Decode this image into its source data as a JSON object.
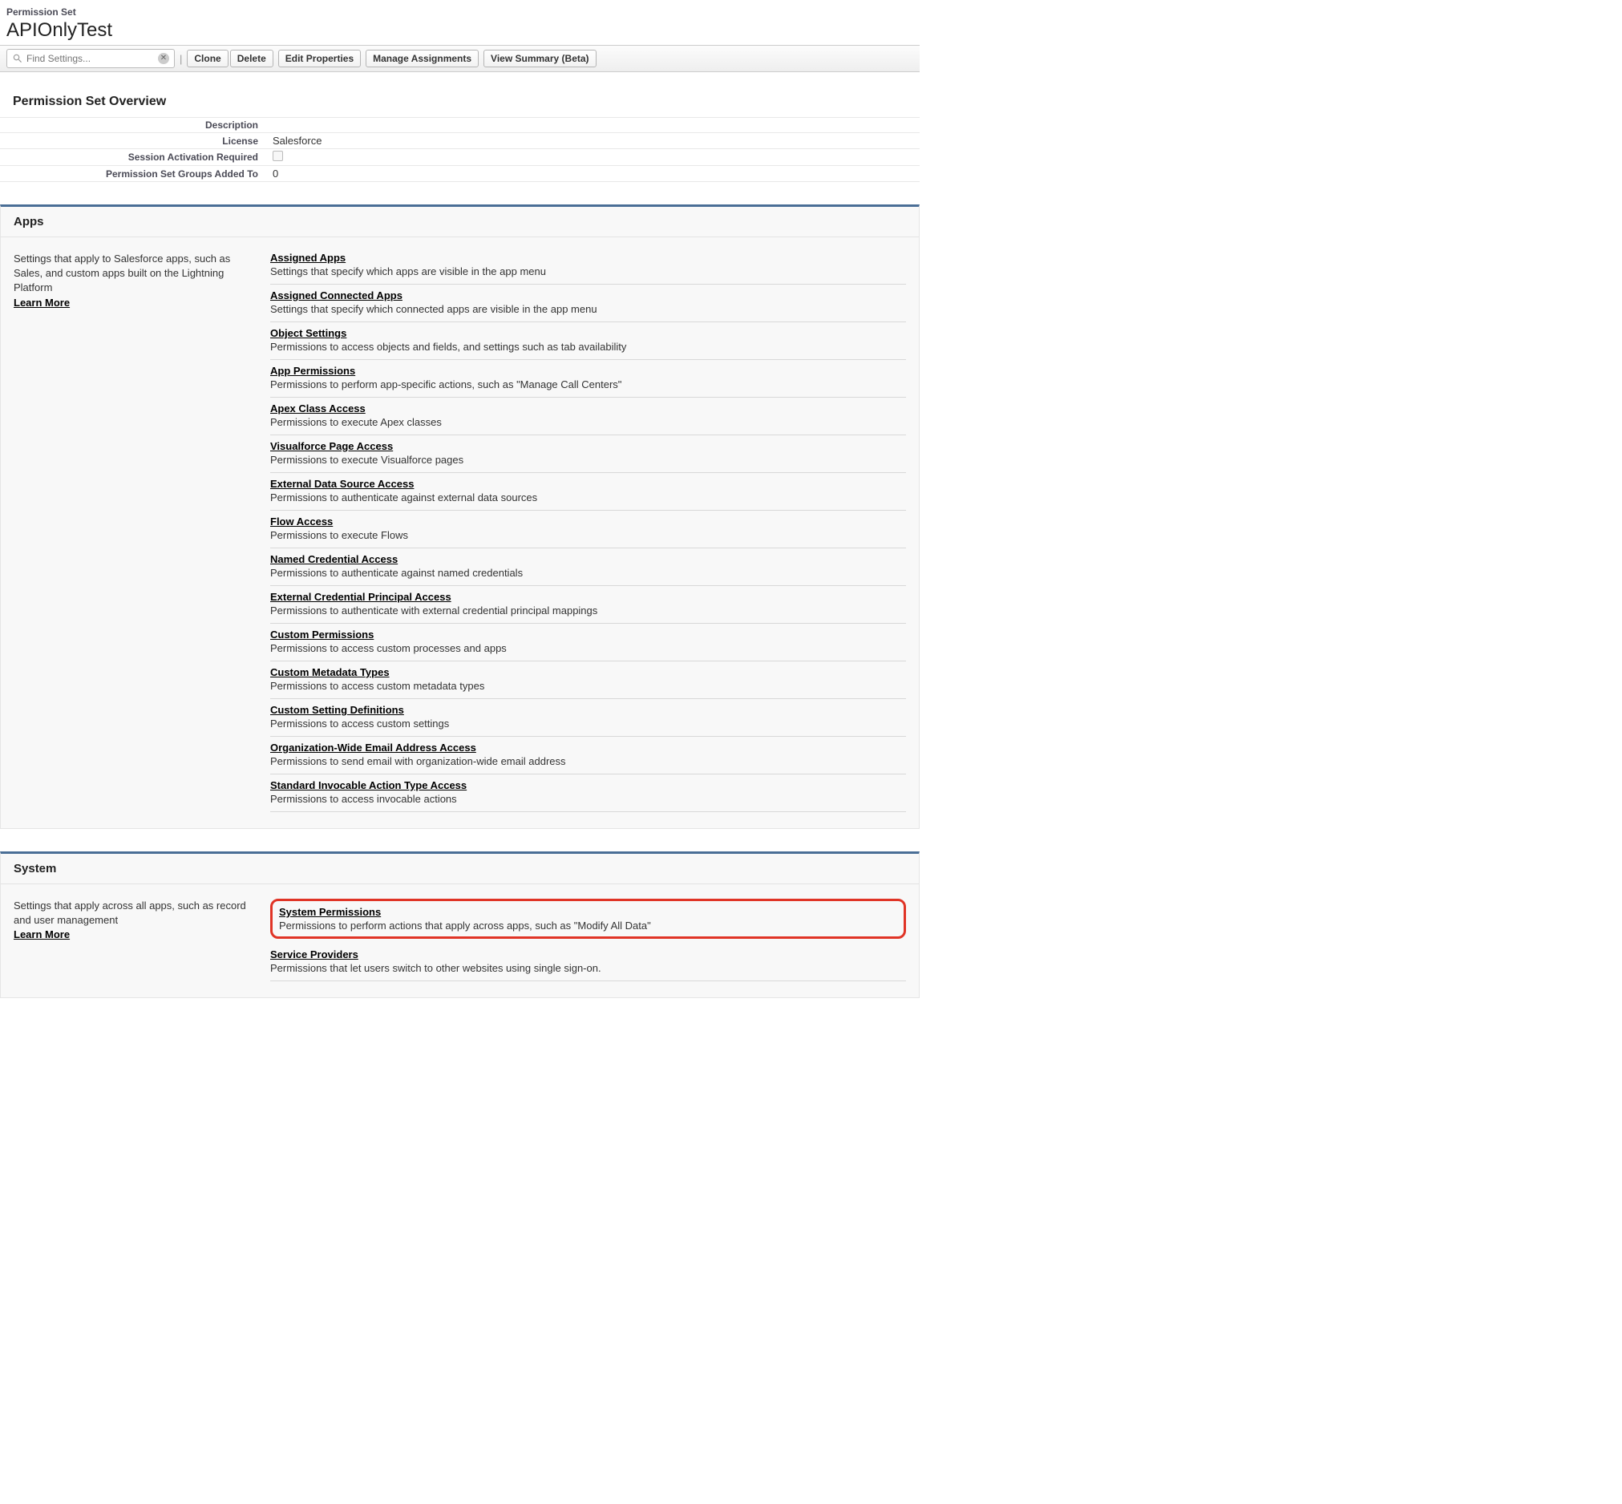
{
  "header": {
    "type_label": "Permission Set",
    "title": "APIOnlyTest"
  },
  "toolbar": {
    "search_placeholder": "Find Settings...",
    "buttons": {
      "clone": "Clone",
      "delete": "Delete",
      "edit_properties": "Edit Properties",
      "manage_assignments": "Manage Assignments",
      "view_summary": "View Summary (Beta)"
    }
  },
  "overview": {
    "title": "Permission Set Overview",
    "rows": {
      "description_label": "Description",
      "description_value": "",
      "license_label": "License",
      "license_value": "Salesforce",
      "session_label": "Session Activation Required",
      "groups_label": "Permission Set Groups Added To",
      "groups_value": "0"
    }
  },
  "apps_section": {
    "title": "Apps",
    "blurb": "Settings that apply to Salesforce apps, such as Sales, and custom apps built on the Lightning Platform",
    "learn_more": "Learn More",
    "items": [
      {
        "title": "Assigned Apps",
        "desc": "Settings that specify which apps are visible in the app menu"
      },
      {
        "title": "Assigned Connected Apps",
        "desc": "Settings that specify which connected apps are visible in the app menu"
      },
      {
        "title": "Object Settings",
        "desc": "Permissions to access objects and fields, and settings such as tab availability"
      },
      {
        "title": "App Permissions",
        "desc": "Permissions to perform app-specific actions, such as \"Manage Call Centers\""
      },
      {
        "title": "Apex Class Access",
        "desc": "Permissions to execute Apex classes"
      },
      {
        "title": "Visualforce Page Access",
        "desc": "Permissions to execute Visualforce pages"
      },
      {
        "title": "External Data Source Access",
        "desc": "Permissions to authenticate against external data sources"
      },
      {
        "title": "Flow Access",
        "desc": "Permissions to execute Flows"
      },
      {
        "title": "Named Credential Access",
        "desc": "Permissions to authenticate against named credentials"
      },
      {
        "title": "External Credential Principal Access",
        "desc": "Permissions to authenticate with external credential principal mappings"
      },
      {
        "title": "Custom Permissions",
        "desc": "Permissions to access custom processes and apps"
      },
      {
        "title": "Custom Metadata Types",
        "desc": "Permissions to access custom metadata types"
      },
      {
        "title": "Custom Setting Definitions",
        "desc": "Permissions to access custom settings"
      },
      {
        "title": "Organization-Wide Email Address Access",
        "desc": "Permissions to send email with organization-wide email address"
      },
      {
        "title": "Standard Invocable Action Type Access",
        "desc": "Permissions to access invocable actions"
      }
    ]
  },
  "system_section": {
    "title": "System",
    "blurb": "Settings that apply across all apps, such as record and user management",
    "learn_more": "Learn More",
    "items": [
      {
        "title": "System Permissions",
        "desc": "Permissions to perform actions that apply across apps, such as \"Modify All Data\"",
        "highlight": true
      },
      {
        "title": "Service Providers",
        "desc": "Permissions that let users switch to other websites using single sign-on."
      }
    ]
  }
}
